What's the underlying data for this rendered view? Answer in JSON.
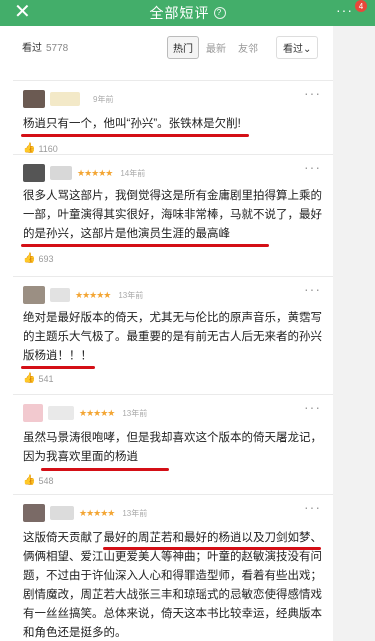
{
  "header": {
    "close_label": "✕",
    "title": "全部短评",
    "help_icon": "?",
    "more_label": "···",
    "badge": "4"
  },
  "filters": {
    "seen_label": "看过",
    "seen_count": "5778",
    "tabs": [
      "热门",
      "最新",
      "友邻"
    ],
    "sort_label": "看过⌄"
  },
  "reviews": [
    {
      "stars": "",
      "ago": "9年前",
      "text": "杨逍只有一个，他叫“孙兴”。张铁林是欠削!",
      "likes": "1160"
    },
    {
      "stars": "★★★★★",
      "ago": "14年前",
      "text": "很多人骂这部片，我倒觉得这是所有金庸剧里拍得算上乘的一部，叶童演得其实很好，海味非常棒，马就不说了，最好的是孙兴，这部片是他演员生涯的最高峰",
      "likes": "693"
    },
    {
      "stars": "★★★★★",
      "ago": "13年前",
      "text": "绝对是最好版本的倚天，尤其无与伦比的原声音乐，黄霑写的主题乐大气极了。最重要的是有前无古人后无来者的孙兴版杨逍！！！",
      "likes": "541"
    },
    {
      "stars": "★★★★★",
      "ago": "13年前",
      "text": "虽然马景涛很咆哮，但是我却喜欢这个版本的倚天屠龙记，因为我喜欢里面的杨逍",
      "likes": "548"
    },
    {
      "stars": "★★★★★",
      "ago": "13年前",
      "text": "这版倚天贡献了最好的周芷若和最好的杨逍以及刀剑如梦、俩俩相望、爱江山更爱美人等神曲；叶童的赵敏演技没有问题，不过由于许仙深入人心和得罪造型师，看着有些出戏；剧情魔改，周芷若大战张三丰和琼瑶式的忌敏恋使得感情戏有一丝丝搞笑。总体来说，倚天这本书比较幸运，经典版本和角色还是挺多的。",
      "likes": ""
    }
  ],
  "colors": {
    "header_green": "#43ae6a",
    "star_orange": "#f3a533",
    "underline_red": "#d40f16",
    "badge_red": "#e8483a"
  }
}
